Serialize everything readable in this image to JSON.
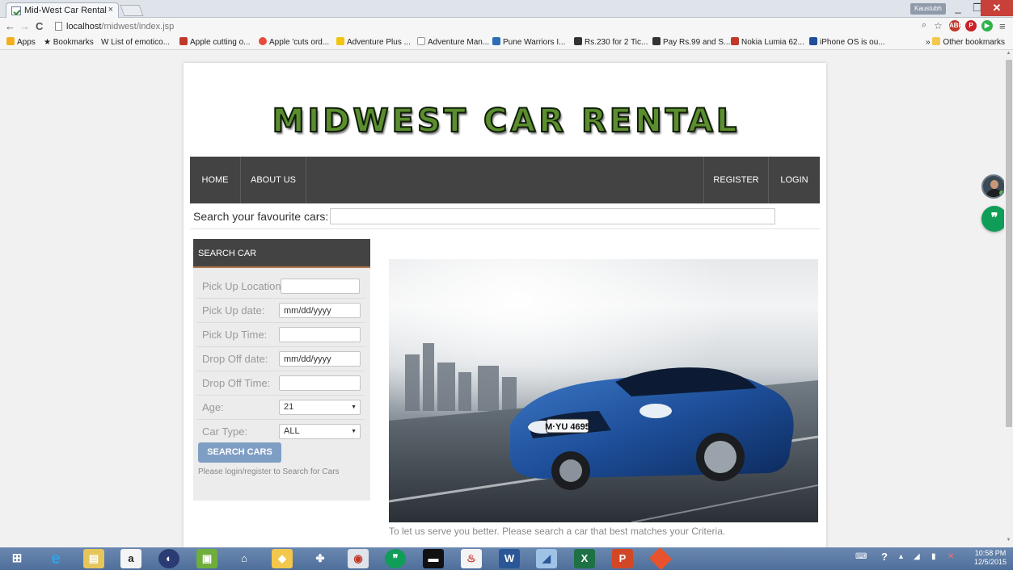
{
  "browser": {
    "tab_title": "Mid-West Car Rental",
    "tab_close": "×",
    "profile_name": "Kaustubh",
    "url_host": "localhost",
    "url_path": "/midwest/index.jsp",
    "bookmarks": [
      {
        "label": "Apps",
        "color": "#f2b01e"
      },
      {
        "label": "Bookmarks",
        "color": "#555555"
      },
      {
        "label": "List of emotico...",
        "color": "#777777"
      },
      {
        "label": "Apple cutting o...",
        "color": "#c0392b"
      },
      {
        "label": "Apple 'cuts ord...",
        "color": "#e74c3c"
      },
      {
        "label": "Adventure Plus ...",
        "color": "#f1c40f"
      },
      {
        "label": "Adventure Man...",
        "color": "#bbbbbb"
      },
      {
        "label": "Pune Warriors I...",
        "color": "#2c6fb6"
      },
      {
        "label": "Rs.230 for 2 Tic...",
        "color": "#333333"
      },
      {
        "label": "Pay Rs.99 and S...",
        "color": "#333333"
      },
      {
        "label": "Nokia Lumia 62...",
        "color": "#c0392b"
      },
      {
        "label": "iPhone OS is ou...",
        "color": "#1f4f9a"
      }
    ],
    "other_bookmarks": "Other bookmarks"
  },
  "site": {
    "logo_part1": "MIDWEST",
    "logo_part2": "CAR",
    "logo_part3": "RENTAL",
    "nav_left": [
      "HOME",
      "ABOUT US"
    ],
    "nav_right": [
      "REGISTER",
      "LOGIN"
    ],
    "search_label": "Search your favourite cars:",
    "search_value": "",
    "panel_title": "SEARCH CAR",
    "fields": [
      {
        "label": "Pick Up Location:",
        "value": "",
        "kind": "text"
      },
      {
        "label": "Pick Up date:",
        "value": "mm/dd/yyyy",
        "kind": "date"
      },
      {
        "label": "Pick Up Time:",
        "value": "",
        "kind": "text"
      },
      {
        "label": "Drop Off date:",
        "value": "mm/dd/yyyy",
        "kind": "date"
      },
      {
        "label": "Drop Off Time:",
        "value": "",
        "kind": "text"
      },
      {
        "label": "Age:",
        "value": "21",
        "kind": "select"
      },
      {
        "label": "Car Type:",
        "value": "ALL",
        "kind": "select"
      }
    ],
    "search_button": "SEARCH CARS",
    "login_note": "Please login/register to Search for Cars",
    "plate_text": "M·YU 4695",
    "caption": "To let us serve you better. Please search a car that best matches your Criteria."
  },
  "taskbar": {
    "time": "10:58 PM",
    "date": "12/5/2015"
  }
}
